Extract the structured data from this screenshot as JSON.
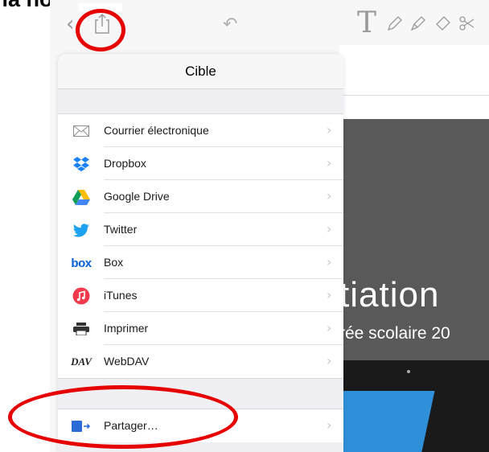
{
  "caption": {
    "text": "» la note."
  },
  "toolbar": {
    "back_icon": "chevron-left-icon",
    "share_icon": "share-icon",
    "undo_icon": "undo-icon",
    "text_tool": "T",
    "tools": [
      "pen-icon",
      "highlighter-icon",
      "eraser-icon",
      "lasso-icon"
    ]
  },
  "popover": {
    "title": "Cible",
    "items": [
      {
        "label": "Courrier électronique",
        "icon": "mail-icon"
      },
      {
        "label": "Dropbox",
        "icon": "dropbox-icon"
      },
      {
        "label": "Google Drive",
        "icon": "google-drive-icon"
      },
      {
        "label": "Twitter",
        "icon": "twitter-icon"
      },
      {
        "label": "Box",
        "icon": "box-icon",
        "icon_text": "box"
      },
      {
        "label": "iTunes",
        "icon": "itunes-icon"
      },
      {
        "label": "Imprimer",
        "icon": "printer-icon"
      },
      {
        "label": "WebDAV",
        "icon": "webdav-icon",
        "icon_text": "DAV"
      }
    ],
    "share_item": {
      "label": "Partager…",
      "icon": "share-out-icon"
    }
  },
  "document": {
    "slide_title": "tiation",
    "slide_subtitle": "rée scolaire 20"
  },
  "colors": {
    "annotation": "#e60000",
    "dropbox": "#1a82fb",
    "twitter": "#1da1f2",
    "box": "#0061d5",
    "itunes": "#f23a4e",
    "share_out": "#2b6bd8"
  }
}
